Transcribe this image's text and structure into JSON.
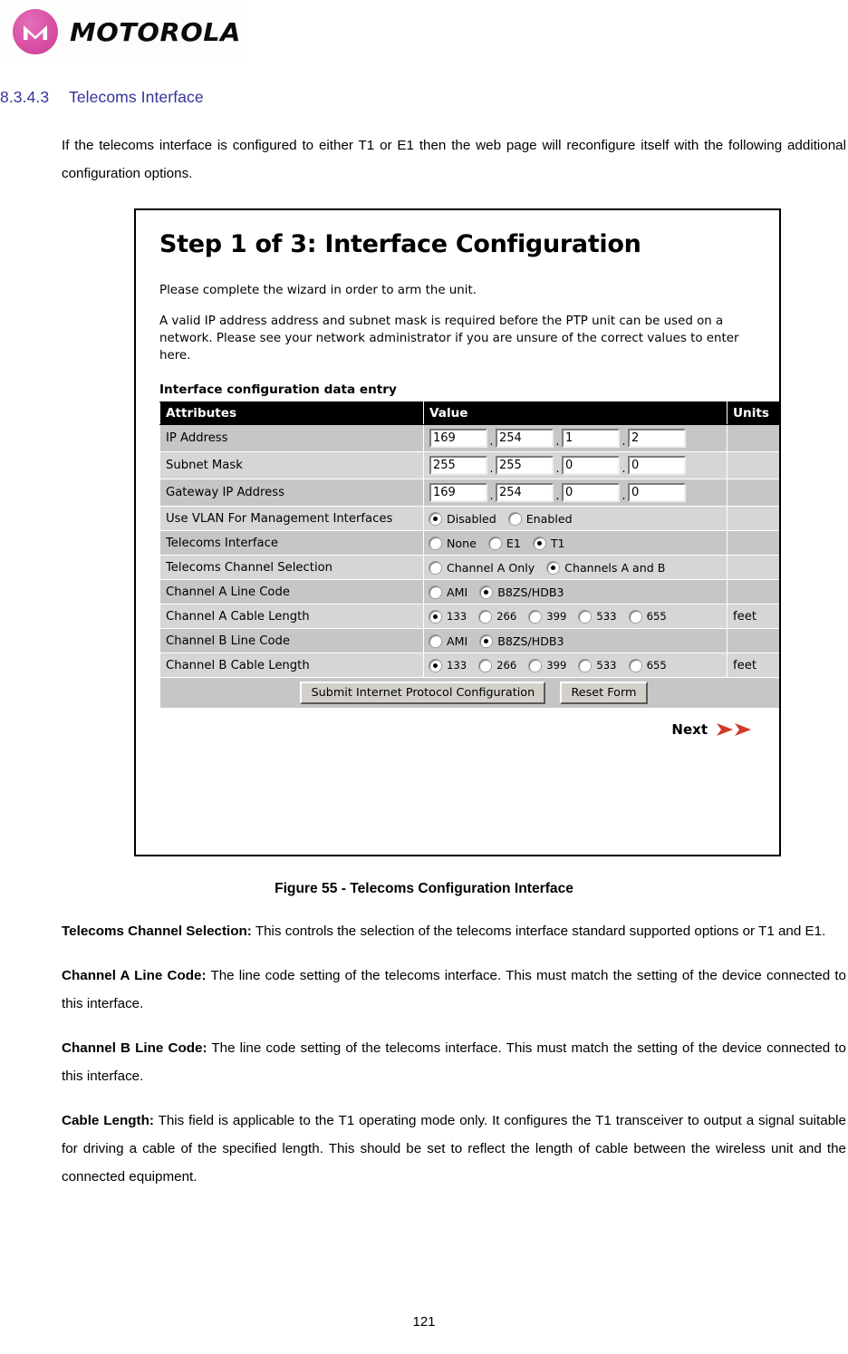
{
  "brand": {
    "logo_word": "MOTOROLA",
    "logo_mark_name": "motorola-m-emblem",
    "logo_color": "#d44fa0"
  },
  "section": {
    "number": "8.3.4.3",
    "title": "Telecoms Interface",
    "color": "#333399"
  },
  "intro_paragraph": "If the telecoms interface is configured to either T1 or E1 then the web page will reconfigure itself with the following additional configuration options.",
  "figure": {
    "caption": "Figure 55 - Telecoms Configuration Interface",
    "screen": {
      "title": "Step 1 of 3: Interface Configuration",
      "paragraph_1": "Please complete the wizard in order to arm the unit.",
      "paragraph_2": "A valid IP address address and subnet mask is required before the PTP unit can be used on a network. Please see your network administrator if you are unsure of the correct values to enter here.",
      "table_title": "Interface configuration data entry",
      "columns": [
        "Attributes",
        "Value",
        "Units"
      ],
      "rows": [
        {
          "attribute": "IP Address",
          "type": "ip",
          "octets": [
            "169",
            "254",
            "1",
            "2"
          ],
          "separator": ".",
          "units": ""
        },
        {
          "attribute": "Subnet Mask",
          "type": "ip",
          "octets": [
            "255",
            "255",
            "0",
            "0"
          ],
          "separator": ".",
          "units": ""
        },
        {
          "attribute": "Gateway IP Address",
          "type": "ip",
          "octets": [
            "169",
            "254",
            "0",
            "0"
          ],
          "separator": ".",
          "units": ""
        },
        {
          "attribute": "Use VLAN For Management Interfaces",
          "type": "radio",
          "options": [
            "Disabled",
            "Enabled"
          ],
          "selected": "Disabled",
          "units": ""
        },
        {
          "attribute": "Telecoms Interface",
          "type": "radio",
          "options": [
            "None",
            "E1",
            "T1"
          ],
          "selected": "T1",
          "units": ""
        },
        {
          "attribute": "Telecoms Channel Selection",
          "type": "radio",
          "options": [
            "Channel A Only",
            "Channels A and B"
          ],
          "selected": "Channels A and B",
          "units": ""
        },
        {
          "attribute": "Channel A Line Code",
          "type": "radio",
          "options": [
            "AMI",
            "B8ZS/HDB3"
          ],
          "selected": "B8ZS/HDB3",
          "units": ""
        },
        {
          "attribute": "Channel A Cable Length",
          "type": "radio",
          "options": [
            "133",
            "266",
            "399",
            "533",
            "655"
          ],
          "selected": "133",
          "units": "feet"
        },
        {
          "attribute": "Channel B Line Code",
          "type": "radio",
          "options": [
            "AMI",
            "B8ZS/HDB3"
          ],
          "selected": "B8ZS/HDB3",
          "units": ""
        },
        {
          "attribute": "Channel B Cable Length",
          "type": "radio",
          "options": [
            "133",
            "266",
            "399",
            "533",
            "655"
          ],
          "selected": "133",
          "units": "feet"
        }
      ],
      "buttons": {
        "submit": "Submit Internet Protocol Configuration",
        "reset": "Reset Form"
      },
      "next": {
        "label": "Next",
        "icon": "double-chevron-right-icon",
        "color": "#d13a26"
      }
    }
  },
  "descriptions": [
    {
      "term": "Telecoms Channel Selection:",
      "text": " This controls the selection of the telecoms interface standard supported options or T1 and E1."
    },
    {
      "term": "Channel A Line Code:",
      "text": " The line code setting of the telecoms interface. This must match the setting of the device connected to this interface."
    },
    {
      "term": "Channel B Line Code:",
      "text": " The line code setting of the telecoms interface. This must match the setting of the device connected to this interface."
    },
    {
      "term": "Cable Length:",
      "text": " This field is applicable to the T1 operating mode only. It configures the T1 transceiver to output a signal suitable for driving a cable of the specified length.  This should be set to reflect the length of cable between the wireless unit and the connected equipment."
    }
  ],
  "page_number": "121"
}
